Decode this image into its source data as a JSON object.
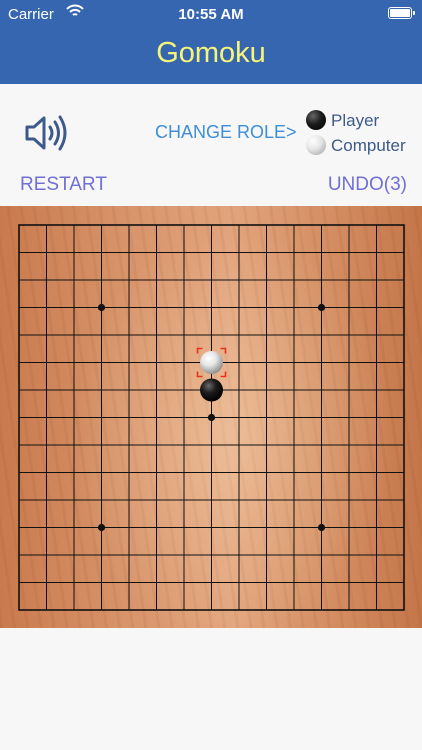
{
  "status_bar": {
    "carrier": "Carrier",
    "time": "10:55 AM"
  },
  "header": {
    "title": "Gomoku"
  },
  "controls": {
    "change_role": "CHANGE ROLE>",
    "legend": [
      {
        "label": "Player",
        "stone": "black"
      },
      {
        "label": "Computer",
        "stone": "white"
      }
    ],
    "restart": "RESTART",
    "undo": "UNDO(3)"
  },
  "colors": {
    "header_bg": "#3766b0",
    "title": "#f6f57a",
    "change_role": "#3e8fd8",
    "legend_text": "#3d5a8a",
    "action": "#6f6fd6",
    "last_move_marker": "#e8321e"
  },
  "icons": {
    "sound": "speaker-icon",
    "wifi": "wifi-icon",
    "battery": "battery-icon"
  },
  "board": {
    "size": 15,
    "star_points": [
      [
        3,
        3
      ],
      [
        11,
        3
      ],
      [
        7,
        7
      ],
      [
        3,
        11
      ],
      [
        11,
        11
      ]
    ],
    "stones": [
      {
        "col": 7,
        "row": 5,
        "color": "white",
        "last_move": true
      },
      {
        "col": 7,
        "row": 6,
        "color": "black",
        "last_move": false
      }
    ]
  }
}
